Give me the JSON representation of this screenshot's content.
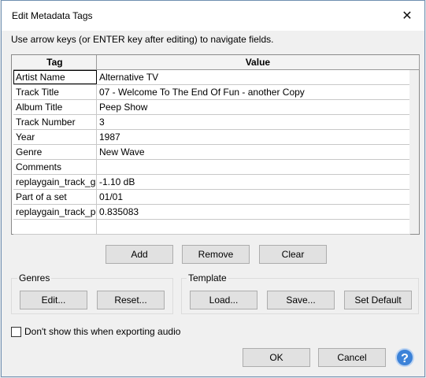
{
  "window": {
    "title": "Edit Metadata Tags"
  },
  "instructions": "Use arrow keys (or ENTER key after editing) to navigate fields.",
  "table": {
    "columns": [
      "Tag",
      "Value"
    ],
    "rows": [
      {
        "tag": "Artist Name",
        "value": "Alternative TV"
      },
      {
        "tag": "Track Title",
        "value": "07 - Welcome To The End Of Fun - another Copy"
      },
      {
        "tag": "Album Title",
        "value": "Peep Show"
      },
      {
        "tag": "Track Number",
        "value": "3"
      },
      {
        "tag": "Year",
        "value": "1987"
      },
      {
        "tag": "Genre",
        "value": "New Wave"
      },
      {
        "tag": "Comments",
        "value": ""
      },
      {
        "tag": "replaygain_track_gain",
        "value": "-1.10 dB"
      },
      {
        "tag": "Part of a set",
        "value": "01/01"
      },
      {
        "tag": "replaygain_track_peak",
        "value": "0.835083"
      },
      {
        "tag": "",
        "value": ""
      }
    ]
  },
  "row_buttons": {
    "add": "Add",
    "remove": "Remove",
    "clear": "Clear"
  },
  "genres": {
    "label": "Genres",
    "edit": "Edit...",
    "reset": "Reset..."
  },
  "template": {
    "label": "Template",
    "load": "Load...",
    "save": "Save...",
    "set_default": "Set Default"
  },
  "dont_show": "Don't show this when exporting audio",
  "footer": {
    "ok": "OK",
    "cancel": "Cancel",
    "help": "?"
  },
  "colors": {
    "accent": "#3c82d8",
    "border": "#6f8fb0"
  }
}
